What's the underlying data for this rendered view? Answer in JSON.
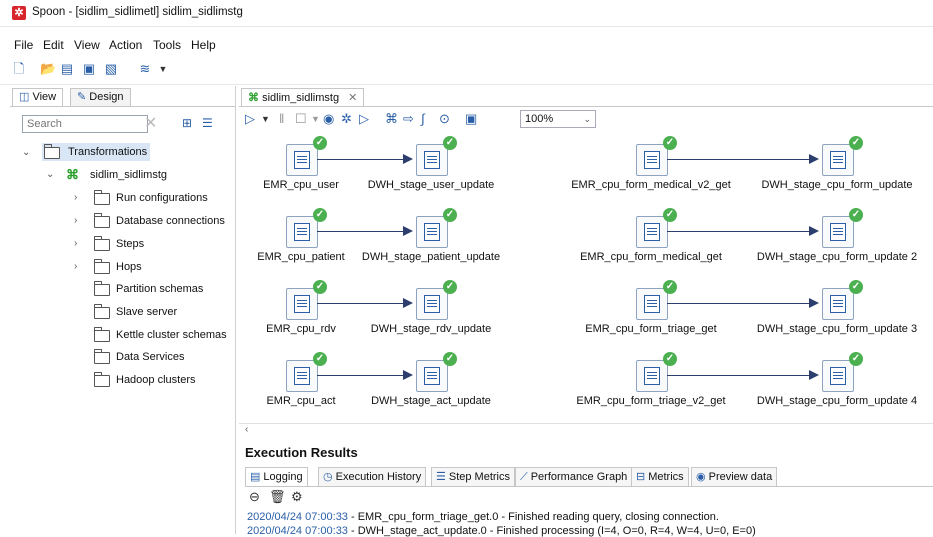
{
  "window": {
    "title": "Spoon - [sidlim_sidlimetl] sidlim_sidlimstg",
    "app_icon": "spoon-icon"
  },
  "menu": [
    "File",
    "Edit",
    "View",
    "Action",
    "Tools",
    "Help"
  ],
  "left_panel": {
    "tabs": [
      "View",
      "Design"
    ],
    "search_placeholder": "Search",
    "tree": {
      "root": "Transformations",
      "transformation": "sidlim_sidlimstg",
      "children": [
        "Run configurations",
        "Database connections",
        "Steps",
        "Hops",
        "Partition schemas",
        "Slave server",
        "Kettle cluster schemas",
        "Data Services",
        "Hadoop clusters"
      ]
    }
  },
  "editor": {
    "tab_label": "sidlim_sidlimstg",
    "zoom": "100%",
    "steps_left": [
      {
        "source": "EMR_cpu_user",
        "target": "DWH_stage_user_update"
      },
      {
        "source": "EMR_cpu_patient",
        "target": "DWH_stage_patient_update"
      },
      {
        "source": "EMR_cpu_rdv",
        "target": "DWH_stage_rdv_update"
      },
      {
        "source": "EMR_cpu_act",
        "target": "DWH_stage_act_update"
      }
    ],
    "steps_right": [
      {
        "source": "EMR_cpu_form_medical_v2_get",
        "target": "DWH_stage_cpu_form_update"
      },
      {
        "source": "EMR_cpu_form_medical_get",
        "target": "DWH_stage_cpu_form_update 2"
      },
      {
        "source": "EMR_cpu_form_triage_get",
        "target": "DWH_stage_cpu_form_update 3"
      },
      {
        "source": "EMR_cpu_form_triage_v2_get",
        "target": "DWH_stage_cpu_form_update 4"
      }
    ]
  },
  "execution": {
    "title": "Execution Results",
    "tabs": [
      "Logging",
      "Execution History",
      "Step Metrics",
      "Performance Graph",
      "Metrics",
      "Preview data"
    ],
    "log": [
      {
        "ts": "2020/04/24 07:00:33",
        "msg": " - EMR_cpu_form_triage_get.0 - Finished reading query, closing connection."
      },
      {
        "ts": "2020/04/24 07:00:33",
        "msg": " - DWH_stage_act_update.0 - Finished processing (I=4, O=0, R=4, W=4, U=0, E=0)"
      }
    ]
  },
  "colors": {
    "accent": "#2a5fa8",
    "success": "#4caf50",
    "hop": "#2c3e6e"
  }
}
